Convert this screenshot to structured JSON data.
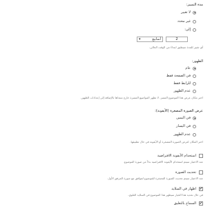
{
  "duration": {
    "title": "مدة التمييز:",
    "options": [
      "لا تغيير",
      "غير محدد",
      "إلى:"
    ],
    "selected_index": 0,
    "number_value": "2",
    "unit_value": "أسابيع",
    "unit_chevron_icon": "chevron-down-icon",
    "description": "أي تغيير للمدة سيطبق ابتداءً من الوقت الحالي."
  },
  "display": {
    "title": "الظهور:",
    "options": [
      "عام",
      "في الصفحة فقط",
      "للرابط فقط",
      "عدم الظهور"
    ],
    "selected_index": 0,
    "description": "اختر مكان عرض هذا الموضوع المميز. لا تظهر المواضيع المميزة خارج منتداها بالإضافة إلى إعدادات الظهور."
  },
  "image": {
    "title": "عرض الصورة المصغرة (الأيقونة):",
    "options": [
      "في اليمين",
      "في اليسار",
      "عدم الظهور"
    ],
    "selected_index": 0,
    "description": "اختر المكان لعرض الصورة المصغرة أو الأيقونة في حال تطبيقها."
  },
  "checkboxes": [
    {
      "label": "استخدام الأيقونة الافتراضية",
      "checked": false,
      "description": "عند الاختيار سيتم استخدام الأيقونة الافتراضية بدلاً من صورة الموضوع."
    },
    {
      "label": "تحديث الصورة",
      "checked": false,
      "description": "عند الاختيار سيتم تحديث الصورة المصغرة للموضوع لتتوافق مع صورة المرفق الأول."
    },
    {
      "label": "اظهار في السلايد",
      "checked": true,
      "description": "في حال تحديد هذا الخيار سيظهر هذا الموضوع في السلايد العلوي."
    },
    {
      "label": "السماح بالتعليق",
      "checked": true,
      "description": ""
    }
  ],
  "colors": {
    "text": "#333333",
    "muted": "#777777",
    "border": "#8a8a8a"
  }
}
